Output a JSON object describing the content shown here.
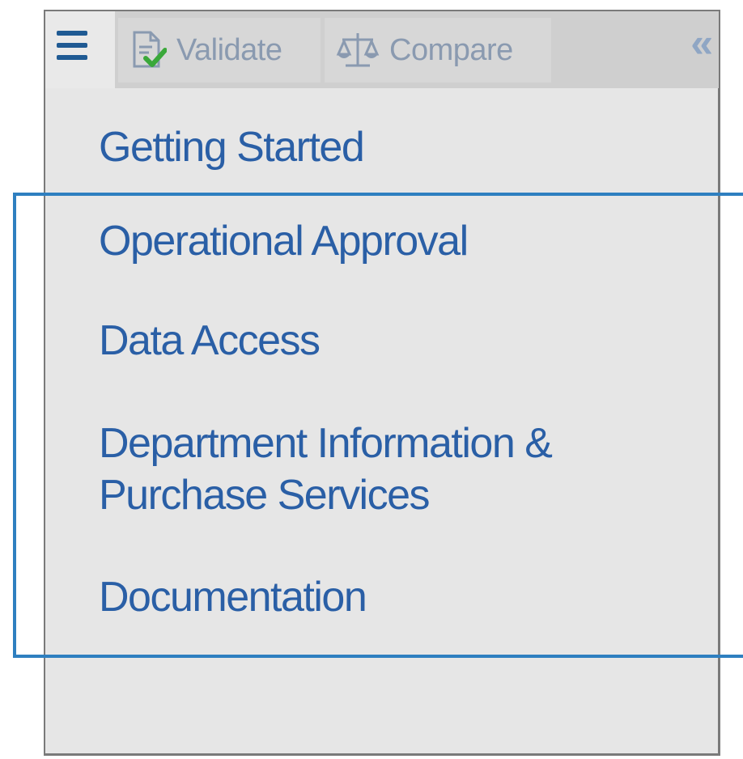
{
  "toolbar": {
    "menu_icon": "hamburger-menu-icon",
    "validate_label": "Validate",
    "validate_icon": "document-check-icon",
    "compare_label": "Compare",
    "compare_icon": "scales-icon",
    "collapse_symbol": "«",
    "collapse_icon": "double-chevron-left-icon"
  },
  "nav": {
    "items": [
      {
        "label": "Getting Started"
      },
      {
        "label": "Operational Approval"
      },
      {
        "label": "Data Access"
      },
      {
        "label": "Department Information &",
        "label_line2": "Purchase Services"
      },
      {
        "label": "Documentation"
      }
    ]
  },
  "colors": {
    "link": "#2a5fa6",
    "highlight_border": "#2e7fc0",
    "panel_bg": "#e6e6e6"
  }
}
